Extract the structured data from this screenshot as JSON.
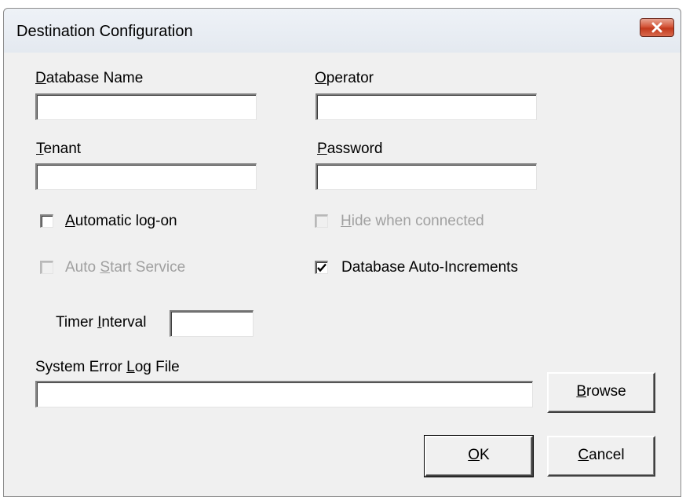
{
  "window": {
    "title": "Destination Configuration"
  },
  "fields": {
    "database_name": {
      "label_accel": "D",
      "label_rest": "atabase Name",
      "value": ""
    },
    "operator": {
      "label_accel": "O",
      "label_rest": "perator",
      "value": ""
    },
    "tenant": {
      "label_accel": "T",
      "label_rest": "enant",
      "value": ""
    },
    "password": {
      "label_accel": "P",
      "label_rest": "assword",
      "value": ""
    },
    "timer_interval": {
      "label_pre": "Timer ",
      "label_accel": "I",
      "label_rest": "nterval",
      "value": ""
    },
    "system_error_log": {
      "label_pre": "System Error ",
      "label_accel": "L",
      "label_rest": "og File",
      "value": ""
    }
  },
  "checkboxes": {
    "automatic_logon": {
      "label_accel": "A",
      "label_rest": "utomatic log-on",
      "checked": false,
      "enabled": true
    },
    "hide_when_connected": {
      "label_accel": "H",
      "label_rest": "ide when connected",
      "checked": false,
      "enabled": false
    },
    "auto_start_service": {
      "label_pre": "Auto ",
      "label_accel": "S",
      "label_rest": "tart Service",
      "checked": false,
      "enabled": false
    },
    "database_auto_increments": {
      "label": "Database Auto-Increments",
      "checked": true,
      "enabled": true
    }
  },
  "buttons": {
    "browse": {
      "label_accel": "B",
      "label_rest": "rowse"
    },
    "ok": {
      "label_accel": "O",
      "label_rest": "K"
    },
    "cancel": {
      "label_accel": "C",
      "label_rest": "ancel"
    }
  },
  "colors": {
    "dialog_bg": "#f0f0f0",
    "disabled_text": "#a0a0a0",
    "close_button": "#c23a1d"
  }
}
